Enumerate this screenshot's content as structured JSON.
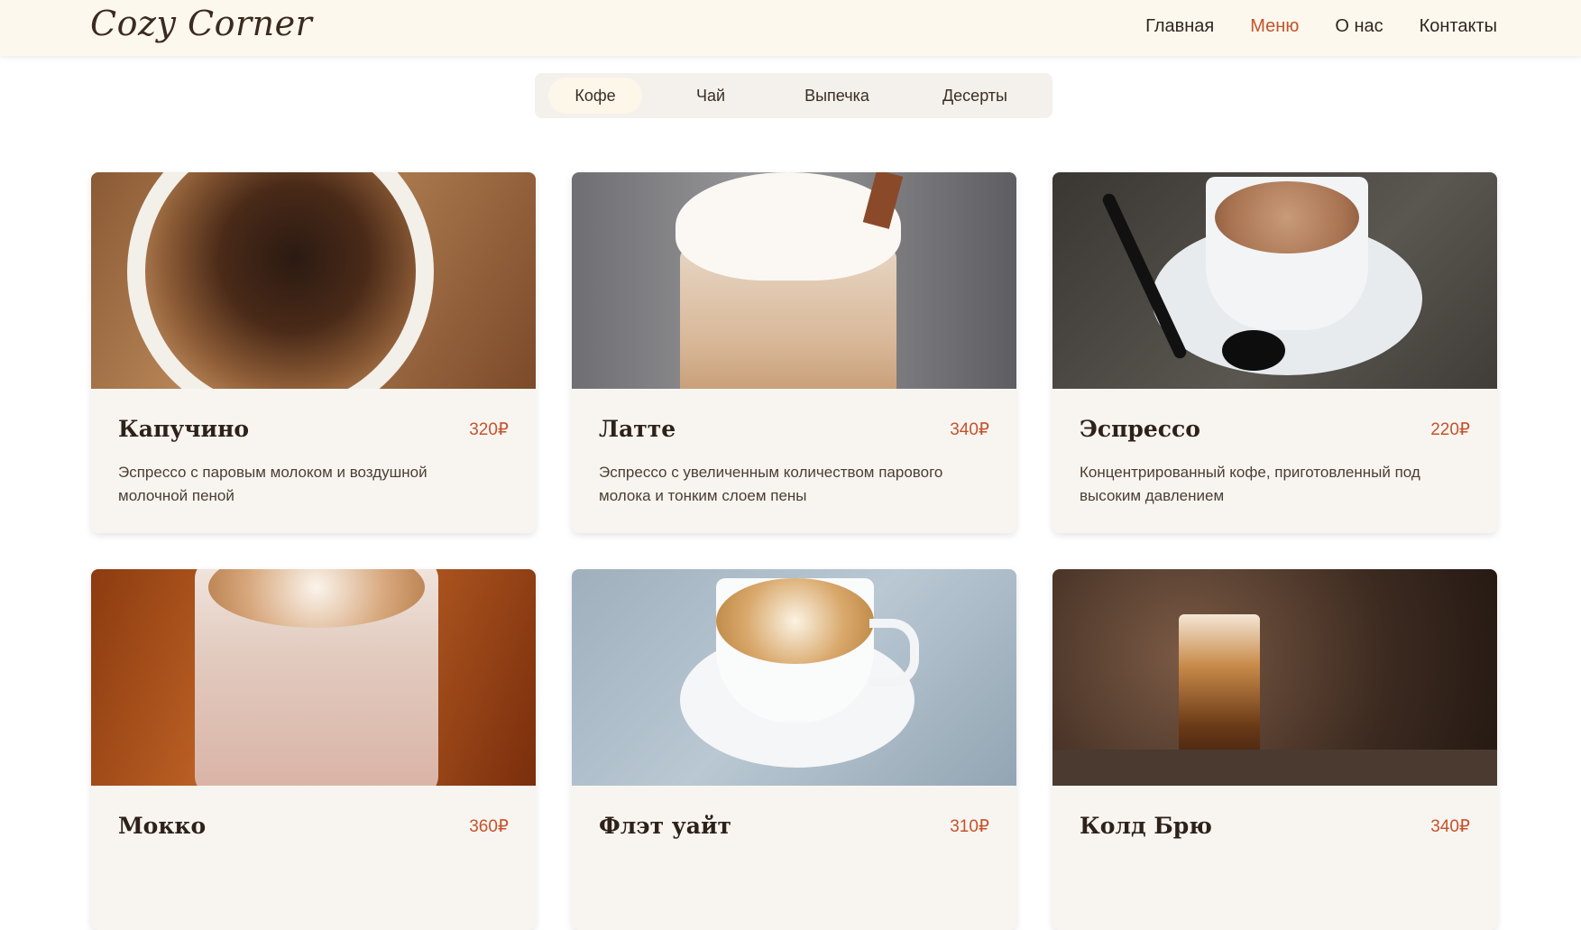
{
  "brand": {
    "logo_text": "Cozy Corner"
  },
  "nav": {
    "items": [
      {
        "label": "Главная",
        "active": false
      },
      {
        "label": "Меню",
        "active": true
      },
      {
        "label": "О нас",
        "active": false
      },
      {
        "label": "Контакты",
        "active": false
      }
    ]
  },
  "tabs": [
    {
      "label": "Кофе",
      "active": true
    },
    {
      "label": "Чай",
      "active": false
    },
    {
      "label": "Выпечка",
      "active": false
    },
    {
      "label": "Десерты",
      "active": false
    }
  ],
  "menu": {
    "items": [
      {
        "name": "Капучино",
        "price": "320₽",
        "description": "Эспрессо с паровым молоком и воздушной молочной пеной",
        "image": "cappuccino-photo"
      },
      {
        "name": "Латте",
        "price": "340₽",
        "description": "Эспрессо с увеличенным количеством парового молока и тонким слоем пены",
        "image": "latte-photo"
      },
      {
        "name": "Эспрессо",
        "price": "220₽",
        "description": "Концентрированный кофе, приготовленный под высоким давлением",
        "image": "espresso-photo"
      },
      {
        "name": "Мокко",
        "price": "360₽",
        "description": "",
        "image": "mocha-photo"
      },
      {
        "name": "Флэт уайт",
        "price": "310₽",
        "description": "",
        "image": "flat-white-photo"
      },
      {
        "name": "Колд Брю",
        "price": "340₽",
        "description": "",
        "image": "cold-brew-photo"
      }
    ]
  },
  "colors": {
    "accent": "#c4532b",
    "header_bg": "#fdf8ee",
    "card_bg": "#f8f5f1",
    "tab_bar_bg": "#f4f0ec",
    "tab_active_bg": "#fdf7ea"
  }
}
